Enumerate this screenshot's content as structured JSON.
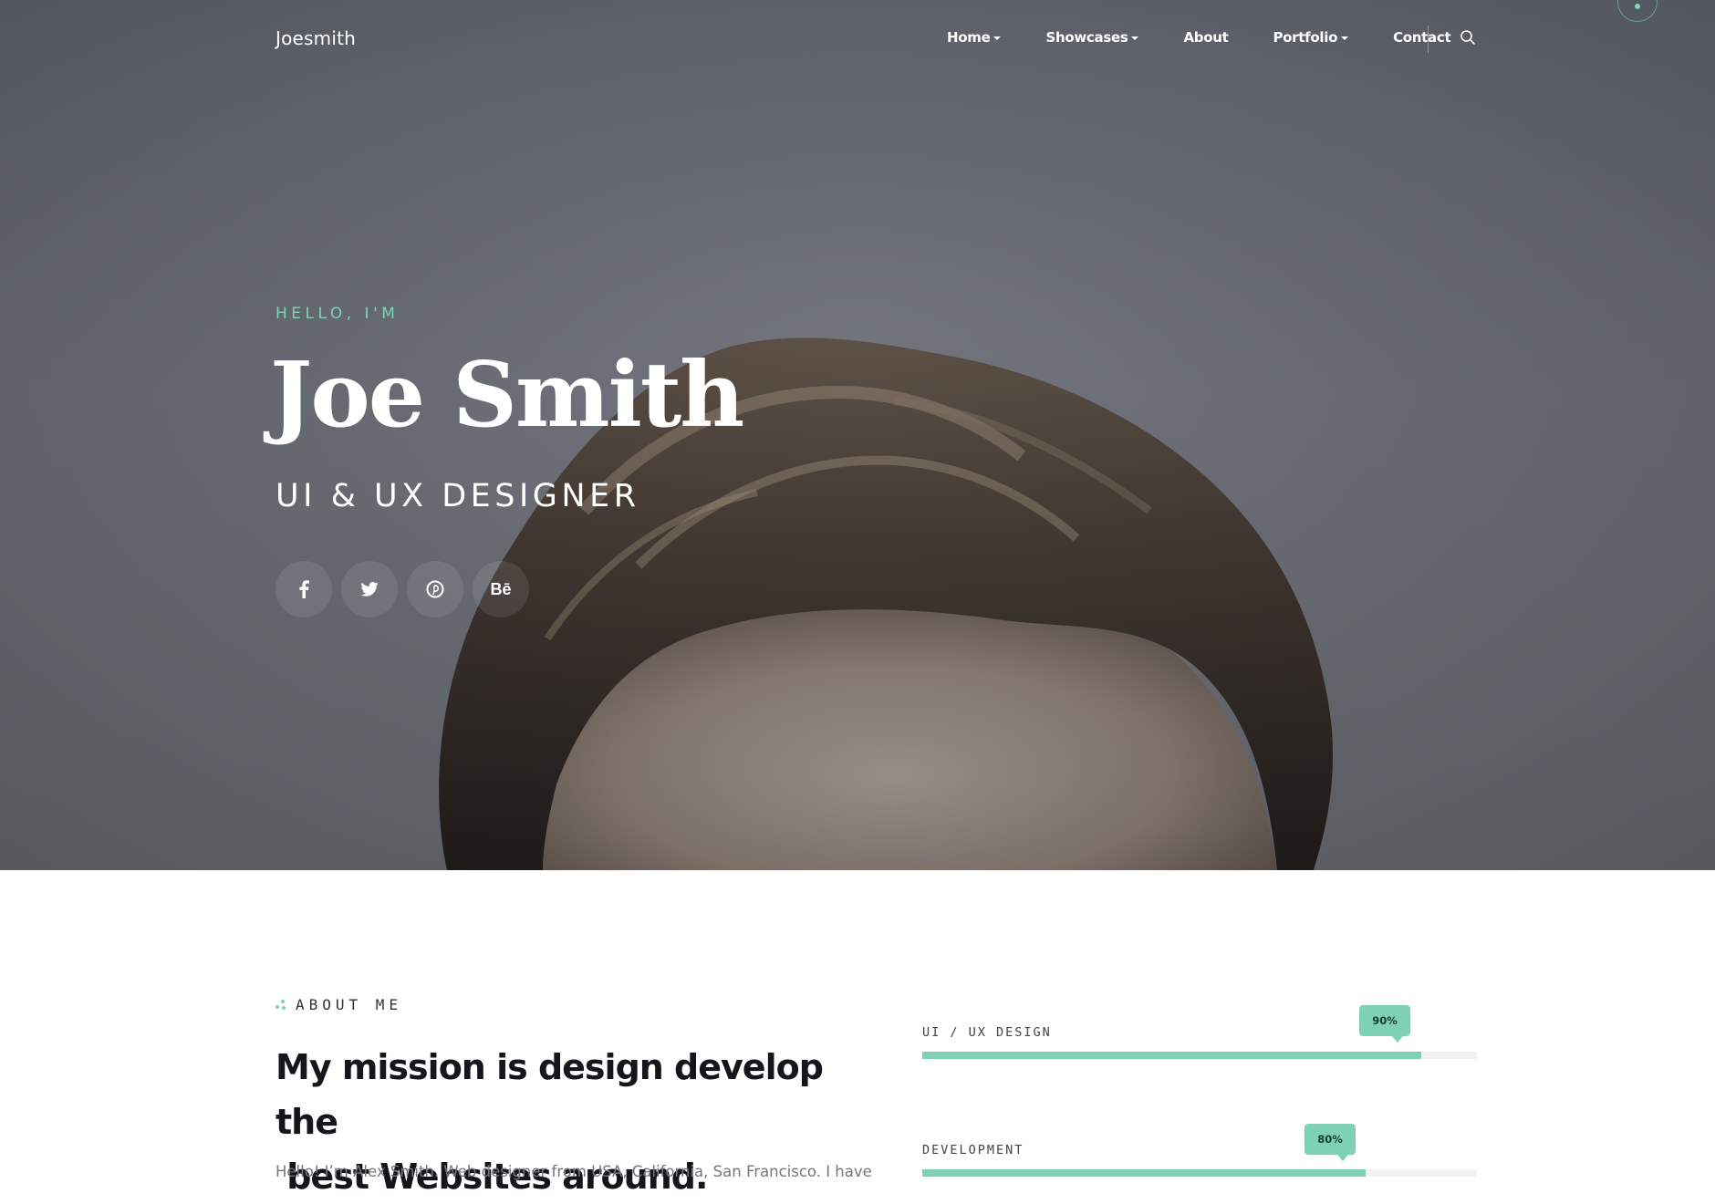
{
  "brand": "Joesmith",
  "nav": {
    "items": [
      {
        "label": "Home",
        "dropdown": true
      },
      {
        "label": "Showcases",
        "dropdown": true
      },
      {
        "label": "About",
        "dropdown": false
      },
      {
        "label": "Portfolio",
        "dropdown": true
      },
      {
        "label": "Contact",
        "dropdown": false
      }
    ],
    "search_icon": "search-icon"
  },
  "hero": {
    "greeting": "HELLO, I'M",
    "name": "Joe Smith",
    "role": "UI & UX DESIGNER",
    "socials": [
      {
        "name": "facebook",
        "glyph": "f"
      },
      {
        "name": "twitter",
        "glyph": "twitter"
      },
      {
        "name": "pinterest",
        "glyph": "pinterest"
      },
      {
        "name": "behance",
        "glyph": "Bē"
      }
    ]
  },
  "about": {
    "label": "ABOUT ME",
    "mission_line1": "My mission is design develop the",
    "mission_line2": " best Websites around.",
    "intro": "Hello! I’m Alex Smith. Web designer from USA, California, San Francisco. I have"
  },
  "skills": [
    {
      "name": "UI / UX DESIGN",
      "percent": 90,
      "label": "90%"
    },
    {
      "name": "DEVELOPMENT",
      "percent": 80,
      "label": "80%"
    }
  ],
  "colors": {
    "accent": "#7ed2b3",
    "hero_bg": "#676a72",
    "heading": "#15161c",
    "body_text": "#777777"
  }
}
